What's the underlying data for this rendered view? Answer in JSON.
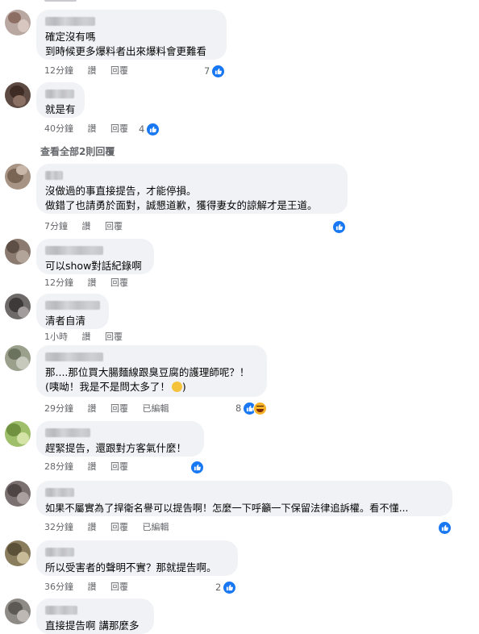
{
  "colors": {
    "bubble": "#f0f2f5",
    "meta": "#65676b",
    "like_blue": "#1877f2"
  },
  "comments": [
    {
      "lines": [
        "確定沒有嗎",
        "到時候更多爆料者出來爆料會更難看"
      ],
      "time": "12分鐘",
      "like": "讚",
      "reply": "回覆",
      "edited": "",
      "reactions": "7",
      "reaction_icons": [
        "like-icon"
      ]
    },
    {
      "lines": [
        "就是有"
      ],
      "time": "40分鐘",
      "like": "讚",
      "reply": "回覆",
      "edited": "",
      "reactions": "4",
      "reaction_icons": [
        "like-icon"
      ]
    },
    {
      "lines": [
        "沒做過的事直接提告，才能停損。",
        "做錯了也請勇於面對，誠懇道歉，獲得妻女的諒解才是王道。"
      ],
      "time": "7分鐘",
      "like": "讚",
      "reply": "回覆",
      "edited": "",
      "reactions": "",
      "reaction_icons": [
        "like-icon"
      ]
    },
    {
      "lines": [
        "可以show對話紀錄啊"
      ],
      "time": "12分鐘",
      "like": "讚",
      "reply": "回覆",
      "edited": "",
      "reactions": "",
      "reaction_icons": []
    },
    {
      "lines": [
        "清者自清"
      ],
      "time": "1小時",
      "like": "讚",
      "reply": "回覆",
      "edited": "",
      "reactions": "",
      "reaction_icons": []
    },
    {
      "lines": [
        "那....那位買大腸麵線跟臭豆腐的護理師呢？！",
        "(咦呦！我是不是問太多了！"
      ],
      "line_suffix": ")",
      "time": "29分鐘",
      "like": "讚",
      "reply": "回覆",
      "edited": "已編輯",
      "reactions": "8",
      "reaction_icons": [
        "like-icon",
        "haha-icon"
      ]
    },
    {
      "lines": [
        "趕緊提告，還跟對方客氣什麼！"
      ],
      "time": "28分鐘",
      "like": "讚",
      "reply": "回覆",
      "edited": "",
      "reactions": "",
      "reaction_icons": [
        "like-icon"
      ]
    },
    {
      "lines": [
        "如果不屬實為了捍衛名譽可以提告啊！怎麼一下呼籲一下保留法律追訴權。看不懂..."
      ],
      "time": "32分鐘",
      "like": "讚",
      "reply": "回覆",
      "edited": "已編輯",
      "reactions": "",
      "reaction_icons": [
        "like-icon"
      ]
    },
    {
      "lines": [
        "所以受害者的聲明不實？那就提告啊。"
      ],
      "time": "36分鐘",
      "like": "讚",
      "reply": "回覆",
      "edited": "",
      "reactions": "2",
      "reaction_icons": [
        "like-icon"
      ]
    },
    {
      "lines": [
        "直接提告啊 講那麼多"
      ],
      "time": "",
      "like": "",
      "reply": "",
      "edited": "",
      "reactions": "",
      "reaction_icons": []
    }
  ],
  "see_all_replies": "查看全部2則回覆"
}
